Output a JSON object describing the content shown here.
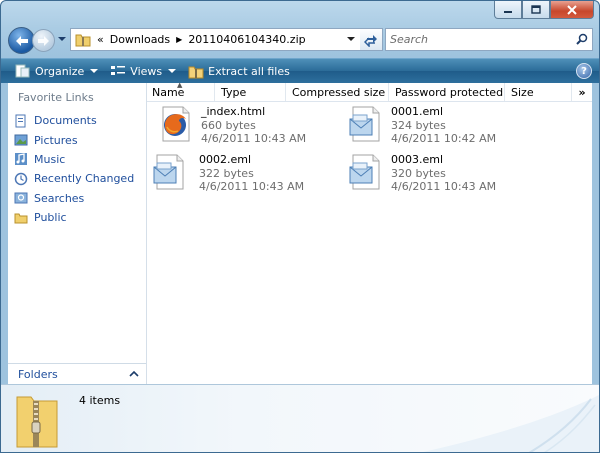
{
  "window": {
    "caption_buttons": [
      "minimize-icon",
      "maximize-icon",
      "close-icon"
    ]
  },
  "address_bar": {
    "chevron": "«",
    "crumbs": [
      "Downloads",
      "20110406104340.zip"
    ],
    "separator": "▶"
  },
  "search": {
    "placeholder": "Search"
  },
  "commands": {
    "organize": "Organize",
    "views": "Views",
    "extract": "Extract all files"
  },
  "nav_pane": {
    "title": "Favorite Links",
    "items": [
      {
        "label": "Documents",
        "icon": "documents-icon"
      },
      {
        "label": "Pictures",
        "icon": "pictures-icon"
      },
      {
        "label": "Music",
        "icon": "music-icon"
      },
      {
        "label": "Recently Changed",
        "icon": "recently-changed-icon"
      },
      {
        "label": "Searches",
        "icon": "searches-icon"
      },
      {
        "label": "Public",
        "icon": "public-folder-icon"
      }
    ],
    "folders_label": "Folders"
  },
  "columns": [
    "Name",
    "Type",
    "Compressed size",
    "Password protected",
    "Size"
  ],
  "columns_more": "»",
  "files": [
    {
      "name": "_index.html",
      "size": "660 bytes",
      "date": "4/6/2011 10:43 AM",
      "icon": "firefox-html-icon"
    },
    {
      "name": "0001.eml",
      "size": "324 bytes",
      "date": "4/6/2011 10:42 AM",
      "icon": "email-file-icon"
    },
    {
      "name": "0002.eml",
      "size": "322 bytes",
      "date": "4/6/2011 10:43 AM",
      "icon": "email-file-icon"
    },
    {
      "name": "0003.eml",
      "size": "320 bytes",
      "date": "4/6/2011 10:43 AM",
      "icon": "email-file-icon"
    }
  ],
  "details": {
    "count": "4 items"
  },
  "help": "?",
  "colors": {
    "accent": "#1f4e9c",
    "command_bar": "#2b6b98"
  }
}
